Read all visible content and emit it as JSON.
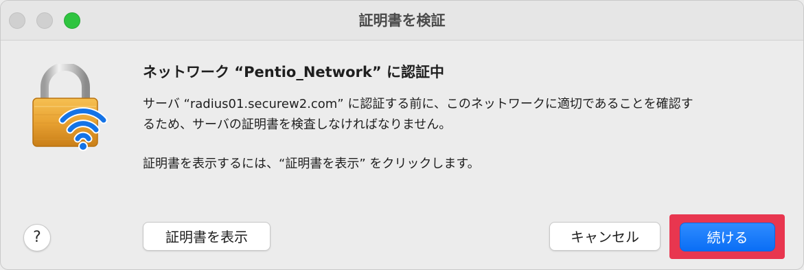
{
  "window": {
    "title": "証明書を検証"
  },
  "content": {
    "heading": "ネットワーク “Pentio_Network” に認証中",
    "line1": "サーバ “radius01.securew2.com” に認証する前に、このネットワークに適切であることを確認す",
    "line2": "るため、サーバの証明書を検査しなければなりません。",
    "line3": "証明書を表示するには、“証明書を表示” をクリックします。"
  },
  "buttons": {
    "help": "?",
    "show_certificate": "証明書を表示",
    "cancel": "キャンセル",
    "continue": "続ける"
  },
  "icons": {
    "main": "wifi-lock-icon"
  },
  "colors": {
    "accent": "#0a6ef5",
    "highlight": "#e8364f",
    "zoom_button": "#2fc440"
  }
}
